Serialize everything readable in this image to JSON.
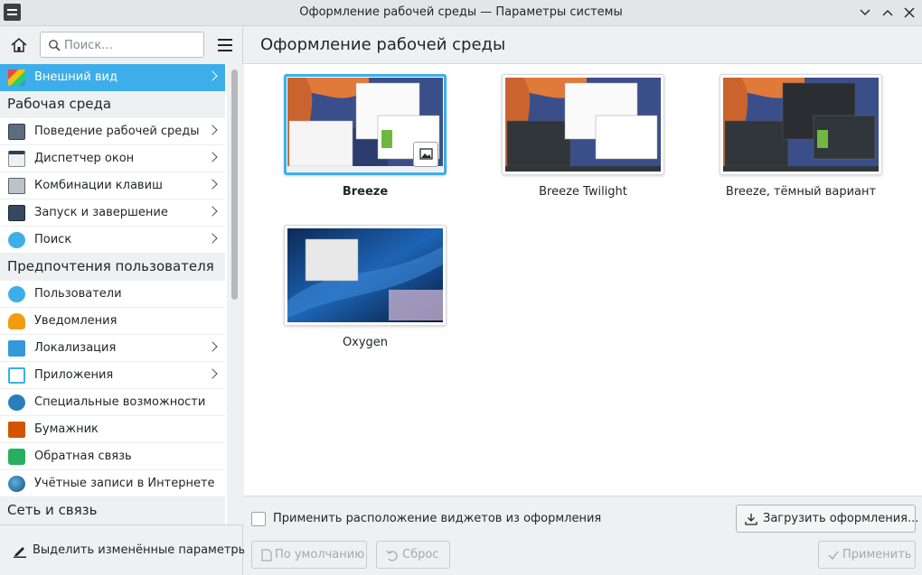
{
  "window": {
    "title": "Оформление рабочей среды — Параметры системы"
  },
  "sidebar": {
    "search_placeholder": "Поиск...",
    "rows": [
      {
        "type": "item",
        "label": "Внешний вид",
        "icon": "appearance-icon",
        "chevron": true,
        "active": true
      },
      {
        "type": "category",
        "label": "Рабочая среда"
      },
      {
        "type": "item",
        "label": "Поведение рабочей среды",
        "icon": "workspace-behavior-icon",
        "chevron": true
      },
      {
        "type": "item",
        "label": "Диспетчер окон",
        "icon": "window-manager-icon",
        "chevron": true
      },
      {
        "type": "item",
        "label": "Комбинации клавиш",
        "icon": "keyboard-icon",
        "chevron": true
      },
      {
        "type": "item",
        "label": "Запуск и завершение",
        "icon": "startup-shutdown-icon",
        "chevron": true
      },
      {
        "type": "item",
        "label": "Поиск",
        "icon": "search-settings-icon",
        "chevron": true
      },
      {
        "type": "category",
        "label": "Предпочтения пользователя"
      },
      {
        "type": "item",
        "label": "Пользователи",
        "icon": "users-icon",
        "chevron": false
      },
      {
        "type": "item",
        "label": "Уведомления",
        "icon": "bell-icon",
        "chevron": false
      },
      {
        "type": "item",
        "label": "Локализация",
        "icon": "localization-icon",
        "chevron": true
      },
      {
        "type": "item",
        "label": "Приложения",
        "icon": "applications-icon",
        "chevron": true
      },
      {
        "type": "item",
        "label": "Специальные возможности",
        "icon": "accessibility-icon",
        "chevron": false
      },
      {
        "type": "item",
        "label": "Бумажник",
        "icon": "wallet-icon",
        "chevron": false
      },
      {
        "type": "item",
        "label": "Обратная связь",
        "icon": "feedback-icon",
        "chevron": false
      },
      {
        "type": "item",
        "label": "Учётные записи в Интернете",
        "icon": "globe-icon",
        "chevron": false
      },
      {
        "type": "category",
        "label": "Сеть и связь"
      }
    ],
    "footer_button": "Выделить изменённые параметры"
  },
  "main": {
    "page_title": "Оформление рабочей среды",
    "themes": [
      {
        "name": "Breeze",
        "selected": true,
        "style": "breeze"
      },
      {
        "name": "Breeze Twilight",
        "selected": false,
        "style": "twilight"
      },
      {
        "name": "Breeze, тёмный вариант",
        "selected": false,
        "style": "dark"
      },
      {
        "name": "Oxygen",
        "selected": false,
        "style": "oxygen"
      }
    ],
    "apply_layout_checkbox": {
      "label": "Применить расположение виджетов из оформления",
      "checked": false
    },
    "buttons": {
      "download": "Загрузить оформления...",
      "defaults": "По умолчанию",
      "reset": "Сброс",
      "apply": "Применить"
    }
  },
  "colors": {
    "accent": "#3daee9",
    "window_bg": "#eff0f1",
    "text": "#232629"
  }
}
